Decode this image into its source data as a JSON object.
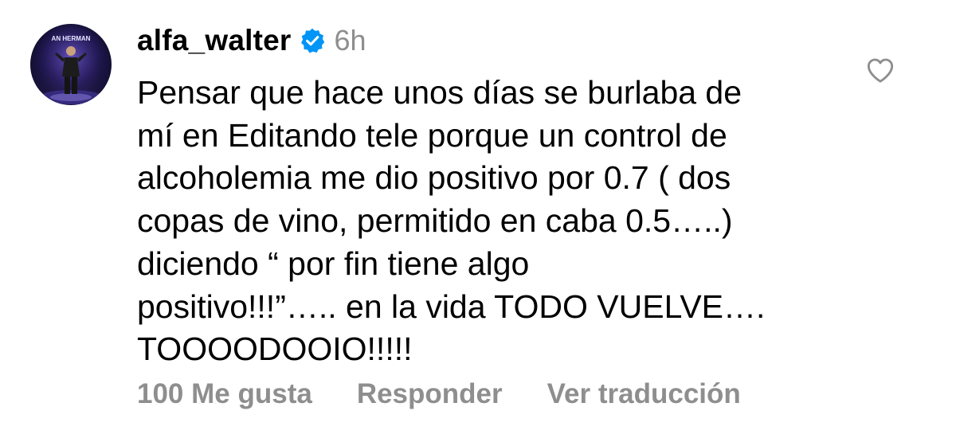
{
  "comment": {
    "username": "alfa_walter",
    "verified": true,
    "timestamp": "6h",
    "avatar_text": "AN HERMAN",
    "text_lines": [
      "Pensar que hace unos días se burlaba de",
      "mí en Editando tele porque un control de",
      "alcoholemia me dio positivo por 0.7 ( dos",
      "copas de vino, permitido en caba 0.5…..)",
      "diciendo “ por fin tiene algo",
      "positivo!!!”….. en la vida TODO VUELVE….",
      "TOOOODOOIO!!!!!"
    ],
    "actions": {
      "likes": "100 Me gusta",
      "reply": "Responder",
      "translate": "Ver traducción"
    },
    "icons": {
      "verified": "verified-badge-icon",
      "like": "heart-icon"
    },
    "colors": {
      "verified": "#0095f6",
      "secondary_text": "#8e8e8e",
      "primary_text": "#000000"
    }
  }
}
